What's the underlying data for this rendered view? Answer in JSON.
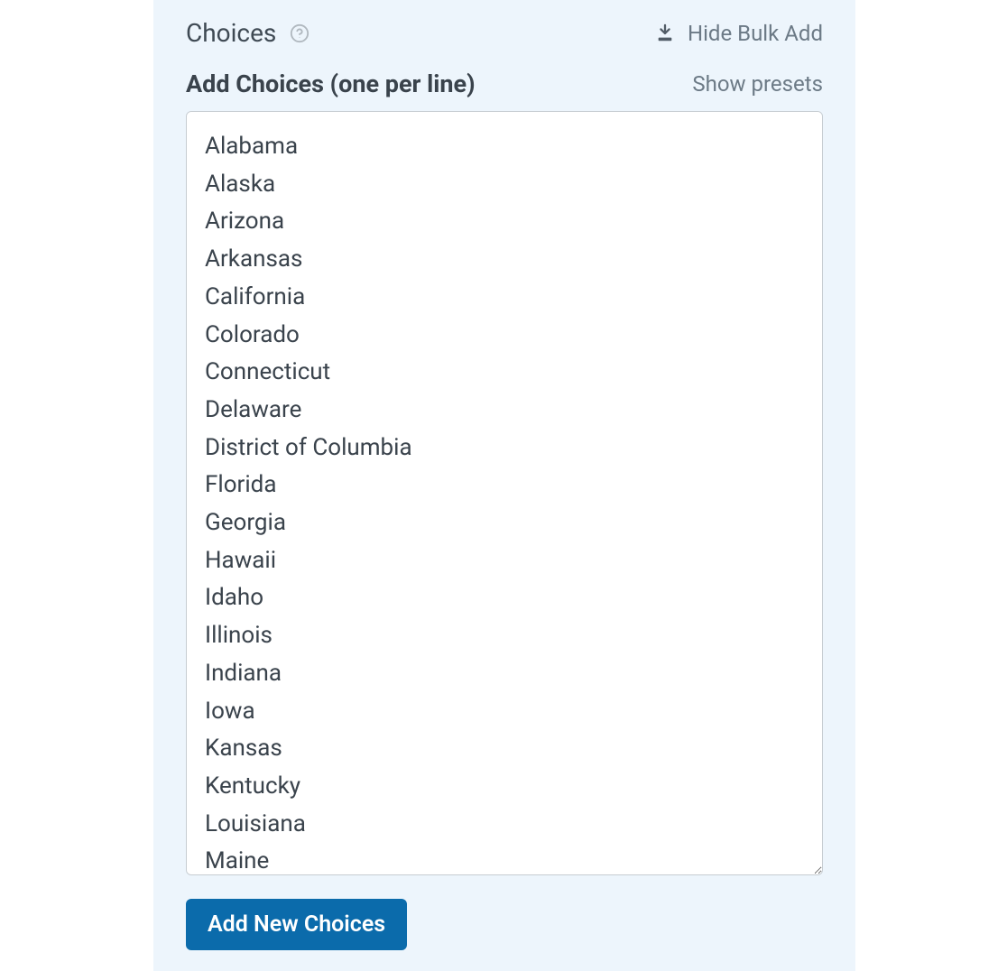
{
  "header": {
    "title": "Choices",
    "hide_bulk_add": "Hide Bulk Add"
  },
  "subheader": {
    "title": "Add Choices (one per line)",
    "show_presets": "Show presets"
  },
  "textarea": {
    "value": "Alabama\nAlaska\nArizona\nArkansas\nCalifornia\nColorado\nConnecticut\nDelaware\nDistrict of Columbia\nFlorida\nGeorgia\nHawaii\nIdaho\nIllinois\nIndiana\nIowa\nKansas\nKentucky\nLouisiana\nMaine"
  },
  "button": {
    "add_label": "Add New Choices"
  }
}
